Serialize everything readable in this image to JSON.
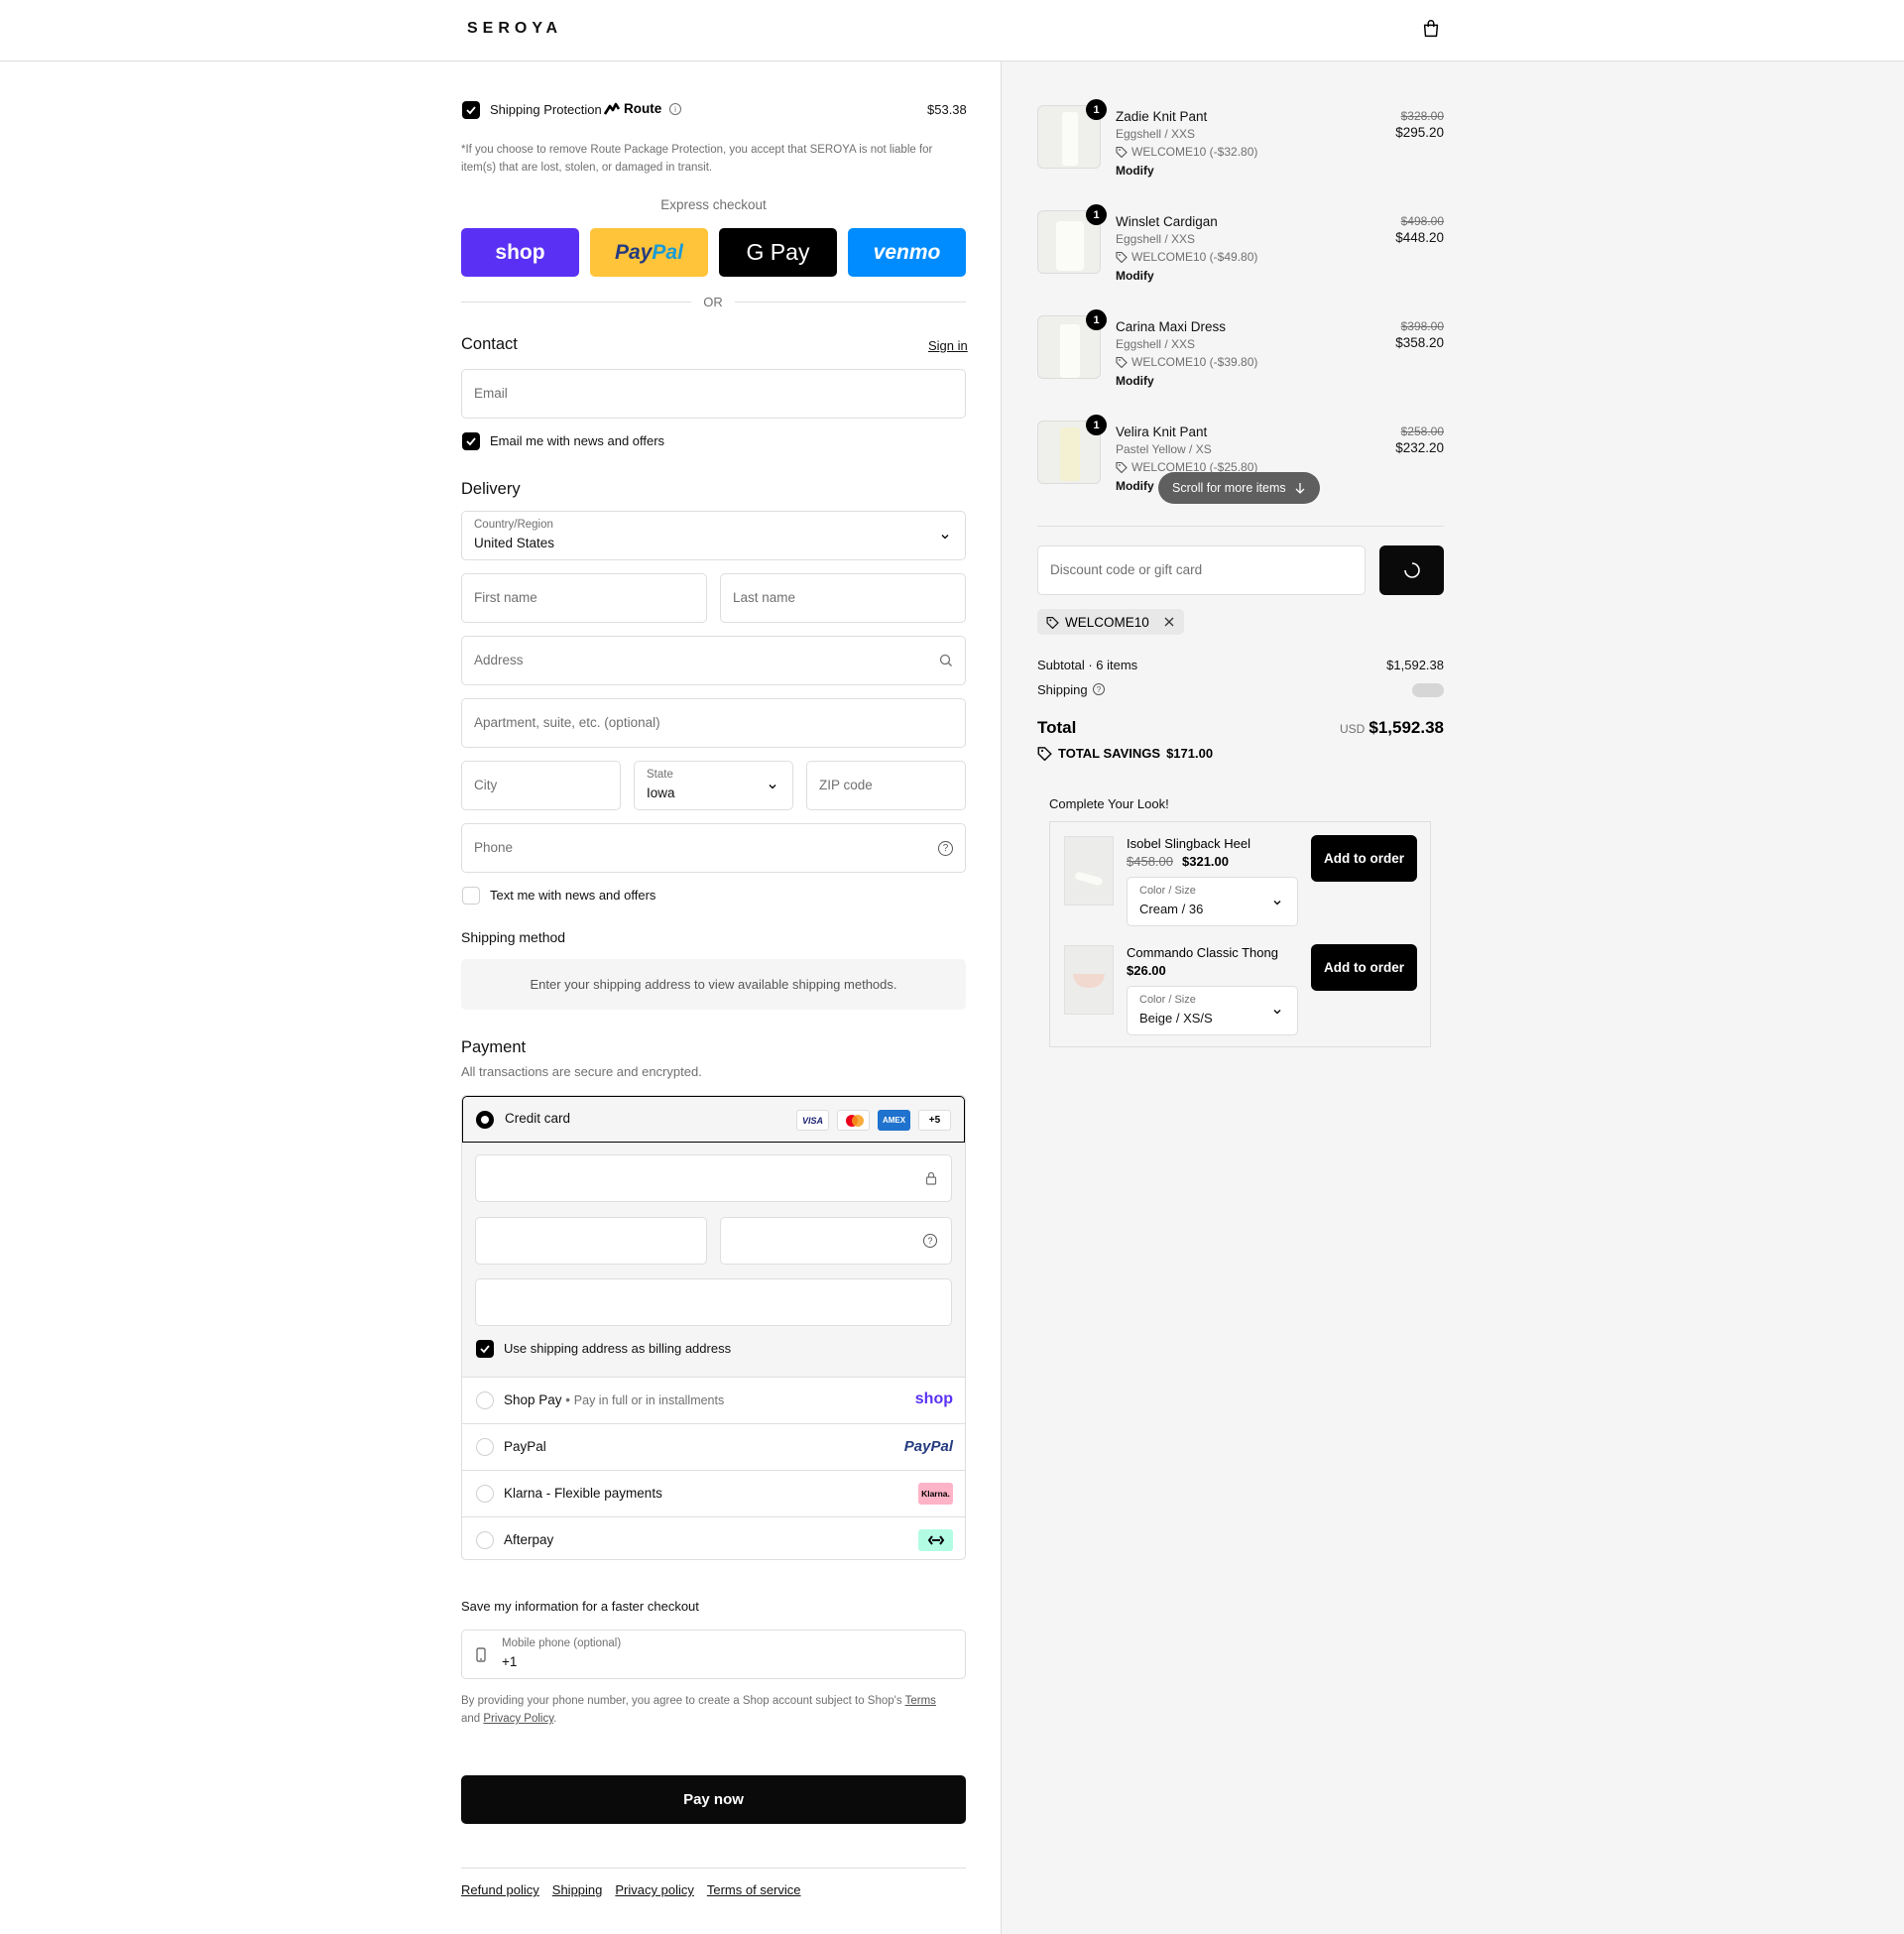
{
  "header": {
    "logo": "SEROYA"
  },
  "protection": {
    "label": "Shipping Protection",
    "brand": "Route",
    "price": "$53.38",
    "note": "*If you choose to remove Route Package Protection, you accept that SEROYA is not liable for item(s) that are lost, stolen, or damaged in transit."
  },
  "express": {
    "title": "Express checkout",
    "buttons": [
      "shop",
      "PayPal",
      "G Pay",
      "venmo"
    ],
    "or": "OR"
  },
  "contact": {
    "title": "Contact",
    "sign_in": "Sign in",
    "email_placeholder": "Email",
    "news_label": "Email me with news and offers"
  },
  "delivery": {
    "title": "Delivery",
    "country_label": "Country/Region",
    "country_value": "United States",
    "first_name": "First name",
    "last_name": "Last name",
    "address": "Address",
    "apartment": "Apartment, suite, etc. (optional)",
    "city": "City",
    "state_label": "State",
    "state_value": "Iowa",
    "zip": "ZIP code",
    "phone": "Phone",
    "text_label": "Text me with news and offers"
  },
  "shipping_method": {
    "title": "Shipping method",
    "message": "Enter your shipping address to view available shipping methods."
  },
  "payment": {
    "title": "Payment",
    "subtitle": "All transactions are secure and encrypted.",
    "credit_card": "Credit card",
    "cards": [
      "VISA",
      "",
      "AMEX",
      "+5"
    ],
    "billing_label": "Use shipping address as billing address",
    "shop_pay": "Shop Pay",
    "shop_pay_sub": "Pay in full or in installments",
    "shop_logo": "shop",
    "paypal": "PayPal",
    "paypal_logo": "PayPal",
    "klarna": "Klarna - Flexible payments",
    "klarna_logo": "Klarna.",
    "afterpay": "Afterpay"
  },
  "save_info": {
    "title": "Save my information for a faster checkout",
    "mobile_label": "Mobile phone (optional)",
    "mobile_value": "+1",
    "legal_pre": "By providing your phone number, you agree to create a Shop account subject to Shop's",
    "terms": "Terms",
    "and": "and",
    "privacy": "Privacy Policy",
    "period": "."
  },
  "pay_now": "Pay now",
  "footer_links": [
    "Refund policy",
    "Shipping",
    "Privacy policy",
    "Terms of service"
  ],
  "order": {
    "items": [
      {
        "name": "Zadie Knit Pant",
        "variant": "Eggshell / XXS",
        "discount": "WELCOME10 (-$32.80)",
        "modify": "Modify",
        "old_price": "$328.00",
        "price": "$295.20",
        "qty": "1"
      },
      {
        "name": "Winslet Cardigan",
        "variant": "Eggshell / XXS",
        "discount": "WELCOME10 (-$49.80)",
        "modify": "Modify",
        "old_price": "$498.00",
        "price": "$448.20",
        "qty": "1"
      },
      {
        "name": "Carina Maxi Dress",
        "variant": "Eggshell / XXS",
        "discount": "WELCOME10 (-$39.80)",
        "modify": "Modify",
        "old_price": "$398.00",
        "price": "$358.20",
        "qty": "1"
      },
      {
        "name": "Velira Knit Pant",
        "variant": "Pastel Yellow / XS",
        "discount": "WELCOME10 (-$25.80)",
        "modify": "Modify",
        "old_price": "$258.00",
        "price": "$232.20",
        "qty": "1"
      }
    ],
    "scroll_hint": "Scroll for more items",
    "discount_placeholder": "Discount code or gift card",
    "applied_code": "WELCOME10",
    "subtotal_label": "Subtotal · 6 items",
    "subtotal_value": "$1,592.38",
    "shipping_label": "Shipping",
    "total_label": "Total",
    "currency": "USD",
    "total_value": "$1,592.38",
    "savings_label": "TOTAL SAVINGS",
    "savings_value": "$171.00"
  },
  "upsell": {
    "title": "Complete Your Look!",
    "items": [
      {
        "name": "Isobel Slingback Heel",
        "old_price": "$458.00",
        "price": "$321.00",
        "option_label": "Color / Size",
        "option_value": "Cream / 36",
        "button": "Add to order"
      },
      {
        "name": "Commando Classic Thong",
        "old_price": "",
        "price": "$26.00",
        "option_label": "Color / Size",
        "option_value": "Beige / XS/S",
        "button": "Add to order"
      }
    ]
  },
  "colors": {
    "shop": "#5a31f4",
    "paypal": "#ffc439",
    "gpay": "#000000",
    "venmo": "#008cff"
  }
}
